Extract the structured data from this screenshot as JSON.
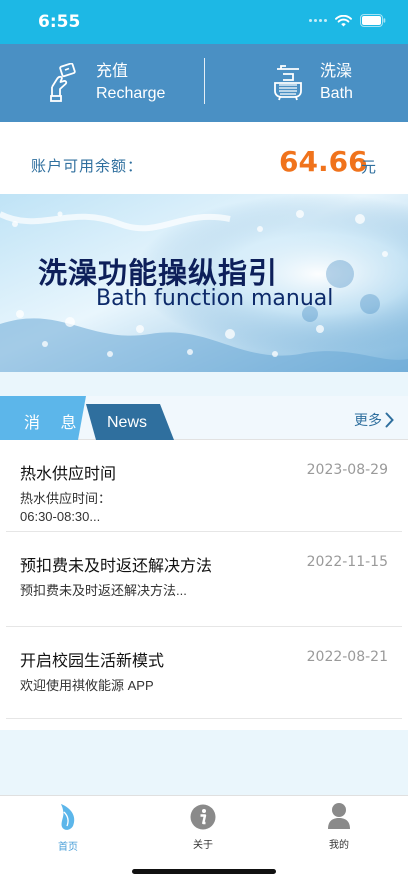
{
  "status_bar": {
    "time": "6:55"
  },
  "actions": {
    "recharge": {
      "label_cn": "充值",
      "label_en": "Recharge",
      "icon": "hand-card-icon"
    },
    "bath": {
      "label_cn": "洗澡",
      "label_en": "Bath",
      "icon": "bathtub-icon"
    }
  },
  "balance": {
    "label": "账户可用余额：",
    "amount": "64.66",
    "unit": "元"
  },
  "banner": {
    "title": "洗澡功能操纵指引",
    "subtitle": "Bath function manual"
  },
  "news": {
    "tab_cn": "消 息",
    "tab_en": "News",
    "more": "更多",
    "items": [
      {
        "title": "热水供应时间",
        "date": "2023-08-29",
        "summary_line1": "热水供应时间：",
        "summary_line2": "06:30-08:30..."
      },
      {
        "title": "预扣费未及时返还解决方法",
        "date": "2022-11-15",
        "summary_line1": "预扣费未及时返还解决方法..."
      },
      {
        "title": "开启校园生活新模式",
        "date": "2022-08-21",
        "summary_line1": "欢迎使用祺攸能源 APP"
      }
    ]
  },
  "tab_bar": {
    "items": [
      {
        "label": "首页",
        "icon": "home-leaf-icon",
        "active": true
      },
      {
        "label": "关于",
        "icon": "info-icon",
        "active": false
      },
      {
        "label": "我的",
        "icon": "person-icon",
        "active": false
      }
    ]
  },
  "colors": {
    "status_bar": "#1db8e5",
    "action_bar": "#4a90c4",
    "amount": "#f0731c",
    "accent": "#2f6f9e"
  }
}
